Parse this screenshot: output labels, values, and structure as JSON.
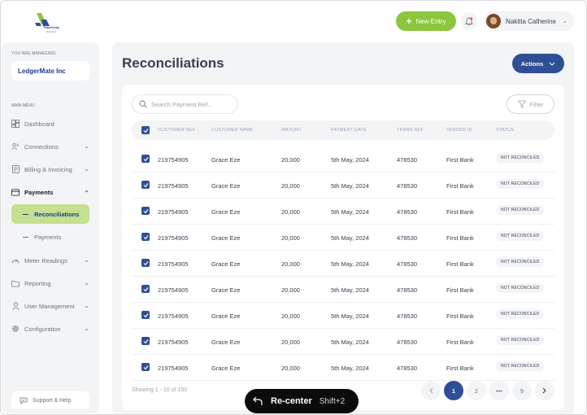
{
  "header": {
    "logo_text": "TraceCorp",
    "logo_sub": "Solutions",
    "new_entry_label": "New Entry",
    "user_name": "Nakitta Catherine",
    "brand_green": "#8cc63f",
    "brand_blue": "#2f4f95"
  },
  "sidebar": {
    "managing_label": "YOU ARE MANAGING:",
    "org_name": "LedgerMate Inc",
    "main_menu_label": "MAIN MENU",
    "items": [
      {
        "label": "Dashboard",
        "icon": "dashboard-icon"
      },
      {
        "label": "Connections",
        "icon": "users-icon"
      },
      {
        "label": "Billing & Invoicing",
        "icon": "document-icon"
      },
      {
        "label": "Payments",
        "icon": "card-icon",
        "expanded": true
      },
      {
        "label": "Meter Readings",
        "icon": "gauge-icon"
      },
      {
        "label": "Reporting",
        "icon": "folder-icon"
      },
      {
        "label": "User Management",
        "icon": "user-icon"
      },
      {
        "label": "Configuration",
        "icon": "gear-icon"
      }
    ],
    "sub_items": [
      {
        "label": "Reconciliations",
        "active": true
      },
      {
        "label": "Payments",
        "active": false
      }
    ],
    "support_label": "Support & Help"
  },
  "main": {
    "title": "Reconciliations",
    "actions_label": "Actions",
    "search_placeholder": "Search Payment Ref...",
    "filter_label": "Filter",
    "columns": [
      "CUSTOMER REF",
      "CUSTOMER NAME",
      "AMOUNT",
      "PAYMENT DATE",
      "TRANS REF",
      "VENDER ID",
      "STATUS"
    ],
    "rows": [
      {
        "ref": "219754905",
        "name": "Grace Eze",
        "amount": "20,000",
        "date": "5th May, 2024",
        "trans": "478530",
        "vendor": "First Bank",
        "status": "NOT RECONCILED",
        "checked": true
      },
      {
        "ref": "219754905",
        "name": "Grace Eze",
        "amount": "20,000",
        "date": "5th May, 2024",
        "trans": "478530",
        "vendor": "First Bank",
        "status": "NOT RECONCILED",
        "checked": true
      },
      {
        "ref": "219754905",
        "name": "Grace Eze",
        "amount": "20,000",
        "date": "5th May, 2024",
        "trans": "478530",
        "vendor": "First Bank",
        "status": "NOT RECONCILED",
        "checked": true
      },
      {
        "ref": "219754905",
        "name": "Grace Eze",
        "amount": "20,000",
        "date": "5th May, 2024",
        "trans": "478530",
        "vendor": "First Bank",
        "status": "NOT RECONCILED",
        "checked": true
      },
      {
        "ref": "219754905",
        "name": "Grace Eze",
        "amount": "20,000",
        "date": "5th May, 2024",
        "trans": "478530",
        "vendor": "First Bank",
        "status": "NOT RECONCILED",
        "checked": true
      },
      {
        "ref": "219754905",
        "name": "Grace Eze",
        "amount": "20,000",
        "date": "5th May, 2024",
        "trans": "478530",
        "vendor": "First Bank",
        "status": "NOT RECONCILED",
        "checked": true
      },
      {
        "ref": "219754905",
        "name": "Grace Eze",
        "amount": "20,000",
        "date": "5th May, 2024",
        "trans": "478530",
        "vendor": "First Bank",
        "status": "NOT RECONCILED",
        "checked": true
      },
      {
        "ref": "219754905",
        "name": "Grace Eze",
        "amount": "20,000",
        "date": "5th May, 2024",
        "trans": "478530",
        "vendor": "First Bank",
        "status": "NOT RECONCILED",
        "checked": true
      },
      {
        "ref": "219754905",
        "name": "Grace Eze",
        "amount": "20,000",
        "date": "5th May, 2024",
        "trans": "478530",
        "vendor": "First Bank",
        "status": "NOT RECONCILED",
        "checked": true
      }
    ],
    "showing_text": "Showing 1 - 10 of 150",
    "pagination": {
      "pages": [
        "1",
        "2",
        "•••",
        "9"
      ],
      "current": "1"
    }
  },
  "overlay": {
    "recenter_label": "Re-center",
    "recenter_shortcut": "Shift+2"
  }
}
